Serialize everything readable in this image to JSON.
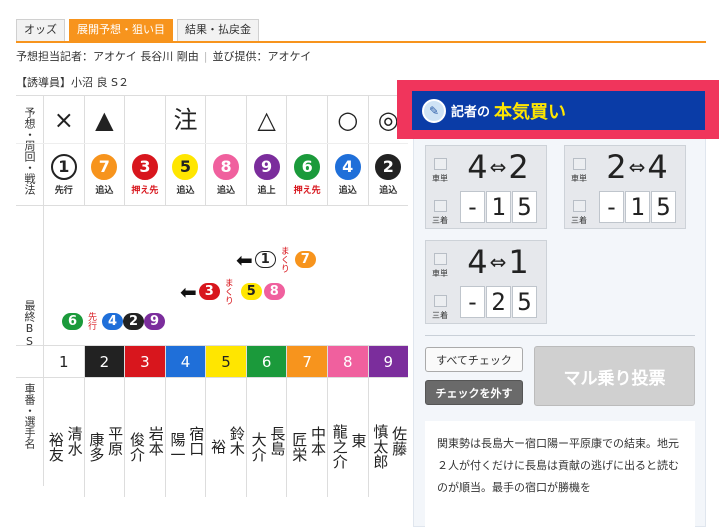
{
  "tabs": [
    {
      "label": "オッズ",
      "active": false
    },
    {
      "label": "展開予想・狙い目",
      "active": true
    },
    {
      "label": "結果・払戻金",
      "active": false
    }
  ],
  "reporter": {
    "text": "予想担当記者：アオケイ 長谷川 剛由",
    "provider": "並び提供：アオケイ"
  },
  "guide": "【誘導員】小沼 良 S２",
  "labels": {
    "prediction": "予想・周回・戦法",
    "bs": "最終BS",
    "riders": "車番・選手名"
  },
  "marks": [
    "×",
    "▲",
    "",
    "注",
    "",
    "△",
    "",
    "○",
    "◎"
  ],
  "styles": [
    {
      "num": "1",
      "text": "先行",
      "red": false
    },
    {
      "num": "7",
      "text": "追込",
      "red": false
    },
    {
      "num": "3",
      "text": "押え先",
      "red": true
    },
    {
      "num": "5",
      "text": "追込",
      "red": false
    },
    {
      "num": "8",
      "text": "追込",
      "red": false
    },
    {
      "num": "9",
      "text": "追上",
      "red": false
    },
    {
      "num": "6",
      "text": "押え先",
      "red": true
    },
    {
      "num": "4",
      "text": "追込",
      "red": false
    },
    {
      "num": "2",
      "text": "追込",
      "red": false
    }
  ],
  "bs": {
    "row1": {
      "arrow": "⬅",
      "first": "1",
      "label": "まくり",
      "second": "7"
    },
    "row2": {
      "arrow": "⬅",
      "first": "3",
      "label": "まくり",
      "a": "5",
      "b": "8"
    },
    "row3": {
      "first": "6",
      "label": "先行",
      "a": "4",
      "b": "2",
      "c": "9"
    }
  },
  "riders": [
    {
      "num": "1",
      "last": "清水",
      "first": "裕友"
    },
    {
      "num": "2",
      "last": "平原",
      "first": "康多"
    },
    {
      "num": "3",
      "last": "岩本",
      "first": "俊介"
    },
    {
      "num": "4",
      "last": "宿口",
      "first": "陽一"
    },
    {
      "num": "5",
      "last": "鈴木",
      "first": "裕"
    },
    {
      "num": "6",
      "last": "長島",
      "first": "大介"
    },
    {
      "num": "7",
      "last": "中本",
      "first": "匠栄"
    },
    {
      "num": "8",
      "last": "東",
      "first": "龍之介"
    },
    {
      "num": "9",
      "last": "佐藤",
      "first": "慎太郎"
    }
  ],
  "colors": {
    "1": {
      "bg": "#ffffff",
      "fg": "#222222",
      "border": "#222222"
    },
    "2": {
      "bg": "#222222",
      "fg": "#ffffff",
      "border": "#222222"
    },
    "3": {
      "bg": "#d8161d",
      "fg": "#ffffff",
      "border": "#d8161d"
    },
    "4": {
      "bg": "#1f6fd9",
      "fg": "#ffffff",
      "border": "#1f6fd9"
    },
    "5": {
      "bg": "#ffe600",
      "fg": "#222222",
      "border": "#ffe600"
    },
    "6": {
      "bg": "#1b9a3b",
      "fg": "#ffffff",
      "border": "#1b9a3b"
    },
    "7": {
      "bg": "#f7941d",
      "fg": "#ffffff",
      "border": "#f7941d"
    },
    "8": {
      "bg": "#f0609e",
      "fg": "#ffffff",
      "border": "#f0609e"
    },
    "9": {
      "bg": "#7b2d9c",
      "fg": "#ffffff",
      "border": "#7b2d9c"
    }
  },
  "banner": {
    "label": "記者の",
    "title": "本気買い",
    "icon": "reporter-avatar-icon"
  },
  "bets": [
    {
      "type1": "車単",
      "type2": "三着",
      "a": "4",
      "b": "2",
      "d1": "-",
      "d2": "1",
      "d3": "5"
    },
    {
      "type1": "車単",
      "type2": "三着",
      "a": "2",
      "b": "4",
      "d1": "-",
      "d2": "1",
      "d3": "5"
    },
    {
      "type1": "車単",
      "type2": "三着",
      "a": "4",
      "b": "1",
      "d1": "-",
      "d2": "2",
      "d3": "5"
    }
  ],
  "buttons": {
    "check_all": "すべてチェック",
    "uncheck": "チェックを外す",
    "vote": "マル乗り投票"
  },
  "comment": "関東勢は長島大ー宿口陽ー平原康での結束。地元２人が付くだけに長島は貢献の逃げに出ると読むのが順当。最手の宿口が勝機を"
}
